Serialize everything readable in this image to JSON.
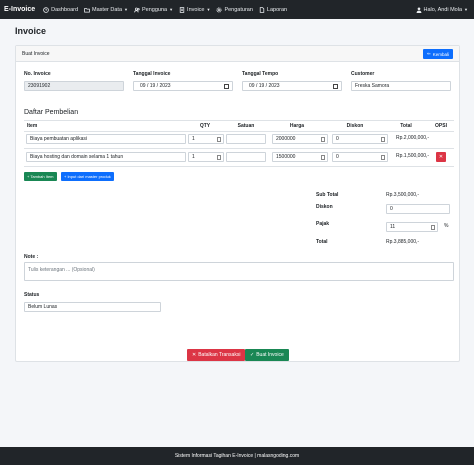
{
  "navbar": {
    "brand": "E-Invoice",
    "items": [
      {
        "label": "Dashboard",
        "icon": "clock-icon"
      },
      {
        "label": "Master Data",
        "icon": "folder-icon",
        "dropdown": true
      },
      {
        "label": "Pengguna",
        "icon": "users-icon",
        "dropdown": true
      },
      {
        "label": "Invoice",
        "icon": "invoice-icon",
        "dropdown": true
      },
      {
        "label": "Pengaturan",
        "icon": "gear-icon"
      },
      {
        "label": "Laporan",
        "icon": "report-icon"
      }
    ],
    "user": "Halo, Andi Mola"
  },
  "page": {
    "title": "Invoice"
  },
  "card": {
    "header_title": "Buat Invoice",
    "back_button": "Kembali"
  },
  "form": {
    "no_invoice_label": "No. Invoice",
    "no_invoice_value": "23091902",
    "tanggal_invoice_label": "Tanggal Invoice",
    "tanggal_invoice_value": "09 / 19 / 2023",
    "tanggal_tempo_label": "Tanggal Tempo",
    "tanggal_tempo_value": "09 / 19 / 2023",
    "customer_label": "Customer",
    "customer_value": "Freska Samora"
  },
  "purchases": {
    "title": "Daftar Pembelian",
    "columns": [
      "Item",
      "QTY",
      "Satuan",
      "Harga",
      "Diskon",
      "Total",
      "OPSI"
    ],
    "rows": [
      {
        "item": "Biaya pembuatan aplikasi",
        "qty": "1",
        "satuan": "",
        "harga": "2000000",
        "diskon": "0",
        "total": "Rp.2,000,000,-"
      },
      {
        "item": "Biaya hosting dan domain selama 1 tahun",
        "qty": "1",
        "satuan": "",
        "harga": "1500000",
        "diskon": "0",
        "total": "Rp.1,500,000,-"
      }
    ],
    "add_item_button": "+ Tambah Item",
    "input_master_button": "+ Input dari master produk"
  },
  "summary": {
    "subtotal_label": "Sub Total",
    "subtotal_value": "Rp.3,500,000,-",
    "diskon_label": "Diskon",
    "diskon_value": "0",
    "pajak_label": "Pajak",
    "pajak_value": "11",
    "pajak_unit": "%",
    "total_label": "Total",
    "total_value": "Rp.3,885,000,-"
  },
  "note": {
    "label": "Note :",
    "placeholder": "Tulis keterangan ... (Opsional)"
  },
  "status": {
    "label": "Status",
    "value": "Belum Lunas"
  },
  "actions": {
    "cancel_button": "Batalkan Transaksi",
    "save_button": "Buat Invoice"
  },
  "footer": {
    "text": "Sistem Informasi Tagihan E-Invoice | malasngoding.com"
  },
  "colors": {
    "primary": "#0d6efd",
    "success": "#198754",
    "danger": "#dc3545",
    "dark": "#212529"
  }
}
